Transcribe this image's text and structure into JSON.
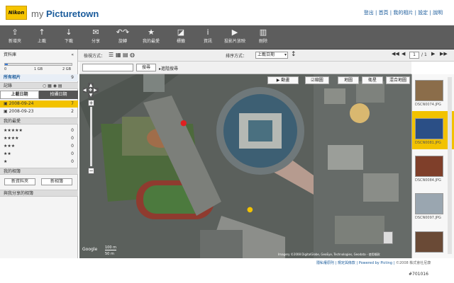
{
  "brand": {
    "logo": "Nikon",
    "prefix": "my ",
    "name": "Picturetown"
  },
  "top_links": {
    "logout": "登出",
    "home": "首頁",
    "my_photos": "我的相片",
    "settings": "設定",
    "help": "說明"
  },
  "toolbar": [
    {
      "icon": "upload-icon",
      "label": "新增夾"
    },
    {
      "icon": "arrow-up-icon",
      "label": "上載"
    },
    {
      "icon": "arrow-down-icon",
      "label": "下載"
    },
    {
      "icon": "mail-icon",
      "label": "分享"
    },
    {
      "icon": "rotate-icon",
      "label": "旋轉"
    },
    {
      "icon": "star-icon",
      "label": "我的最愛"
    },
    {
      "icon": "tag-icon",
      "label": "標籤"
    },
    {
      "icon": "info-icon",
      "label": "資訊"
    },
    {
      "icon": "play-icon",
      "label": "投影片放映"
    },
    {
      "icon": "trash-icon",
      "label": "刪除"
    }
  ],
  "left": {
    "title": "資料庫",
    "storage_left": "0",
    "storage_mid": "1 GB",
    "storage_right": "2 GB",
    "all_photos": "所有相片",
    "all_count": "9",
    "record": "記錄",
    "tab_upload": "上載日期",
    "tab_shot": "拍攝日期",
    "dates": [
      {
        "date": "2008-09-24",
        "count": "7"
      },
      {
        "date": "2008-09-23",
        "count": "2"
      }
    ],
    "fav_title": "我的最愛",
    "stars": [
      {
        "label": "★★★★★",
        "count": "0"
      },
      {
        "label": "★★★★",
        "count": "0"
      },
      {
        "label": "★★★",
        "count": "0"
      },
      {
        "label": "★★",
        "count": "0"
      },
      {
        "label": "★",
        "count": "0"
      }
    ],
    "album_title": "我的相簿",
    "new_album_btn": "新資料夾",
    "new_album2_btn": "新相簿",
    "shared": "與我分享的相簿"
  },
  "filter": {
    "view_label": "檢視方式：",
    "sort_label": "排序方式：",
    "sort_value": "上載日期",
    "search_placeholder": "",
    "search_button": "搜尋",
    "advanced": "進階搜尋",
    "page_current": "1",
    "page_total": "1"
  },
  "map": {
    "play": "動畫",
    "checkbox_label": "縮圖",
    "tab_map": "地圖",
    "tab_satellite": "衛星",
    "tab_hybrid": "混合地圖",
    "scale_m": "100 m",
    "scale_ft": "50 m",
    "copyright": "Imagery ©2008 DigitalGlobe, GeoEye, Technologies, Geodata",
    "terms": "使用條款"
  },
  "thumbnails": [
    {
      "name": "DSCN0074.JPG",
      "color": "#8b6d4a"
    },
    {
      "name": "DSCN0081.JPG",
      "color": "#2b4f86"
    },
    {
      "name": "DSCN0084.JPG",
      "color": "#7f3f2a"
    },
    {
      "name": "DSCN0097.JPG",
      "color": "#9aa6b0"
    },
    {
      "name": "DSCN0103.JPG",
      "color": "#6a4a36"
    }
  ],
  "footer": {
    "privacy": "隱私權原則",
    "terms": "規定與條款",
    "powered": "Powered by Picting",
    "copy": "©2008 株式會社尼康"
  },
  "watermark": "#701016"
}
